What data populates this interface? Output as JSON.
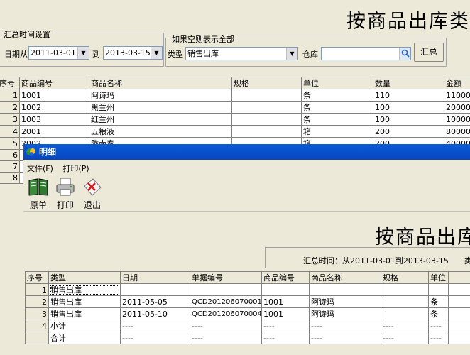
{
  "main": {
    "title": "按商品出库类",
    "summary_group_label": "汇总时间设置",
    "date_from_label": "日期从",
    "date_from_value": "2011-03-01",
    "date_to_label": "到",
    "date_to_value": "2013-03-15",
    "filter_group_label": "如果空则表示全部",
    "type_label": "类型",
    "type_value": "销售出库",
    "warehouse_label": "仓库",
    "warehouse_value": "",
    "summary_button": "汇总",
    "table": {
      "headers": [
        "序号",
        "商品编号",
        "商品名称",
        "规格",
        "单位",
        "数量",
        "金额"
      ],
      "rows": [
        {
          "no": "1",
          "code": "1001",
          "name": "阿诗玛",
          "spec": "",
          "unit": "条",
          "qty": "110",
          "amount": "11000"
        },
        {
          "no": "2",
          "code": "1002",
          "name": "黑兰州",
          "spec": "",
          "unit": "条",
          "qty": "100",
          "amount": "20000"
        },
        {
          "no": "3",
          "code": "1003",
          "name": "红兰州",
          "spec": "",
          "unit": "条",
          "qty": "100",
          "amount": "10000"
        },
        {
          "no": "4",
          "code": "2001",
          "name": "五粮液",
          "spec": "",
          "unit": "箱",
          "qty": "200",
          "amount": "80000"
        },
        {
          "no": "5",
          "code": "2002",
          "name": "陇南春",
          "spec": "",
          "unit": "箱",
          "qty": "200",
          "amount": "40000"
        },
        {
          "no": "6"
        },
        {
          "no": "7"
        },
        {
          "no": "8"
        }
      ]
    }
  },
  "detail_window": {
    "title": "明细",
    "menu": [
      "文件(F)",
      "打印(P)"
    ],
    "toolbar": [
      "原单",
      "打印",
      "退出"
    ],
    "report_title": "按商品出库",
    "summary_time": "汇总时间：从2011-03-01到2013-03-15",
    "summary_type_label": "类",
    "table": {
      "headers": [
        "序号",
        "类型",
        "日期",
        "单据编号",
        "商品编号",
        "商品名称",
        "规格",
        "单位"
      ],
      "rows": [
        {
          "no": "1",
          "type": "销售出库",
          "date": "",
          "doc": "",
          "code": "",
          "name": "",
          "spec": "",
          "unit": ""
        },
        {
          "no": "2",
          "type": "销售出库",
          "date": "2011-05-05",
          "doc": "QCD201206070001",
          "code": "1001",
          "name": "阿诗玛",
          "spec": "",
          "unit": "条"
        },
        {
          "no": "3",
          "type": "销售出库",
          "date": "2011-05-10",
          "doc": "QCD201206070004",
          "code": "1001",
          "name": "阿诗玛",
          "spec": "",
          "unit": "条"
        },
        {
          "no": "4",
          "type": "小计",
          "date": "----",
          "doc": "----",
          "code": "----",
          "name": "----",
          "spec": "----",
          "unit": "----"
        },
        {
          "no": "",
          "type": "合计",
          "date": "----",
          "doc": "----",
          "code": "----",
          "name": "----",
          "spec": "----",
          "unit": "----"
        }
      ]
    }
  }
}
